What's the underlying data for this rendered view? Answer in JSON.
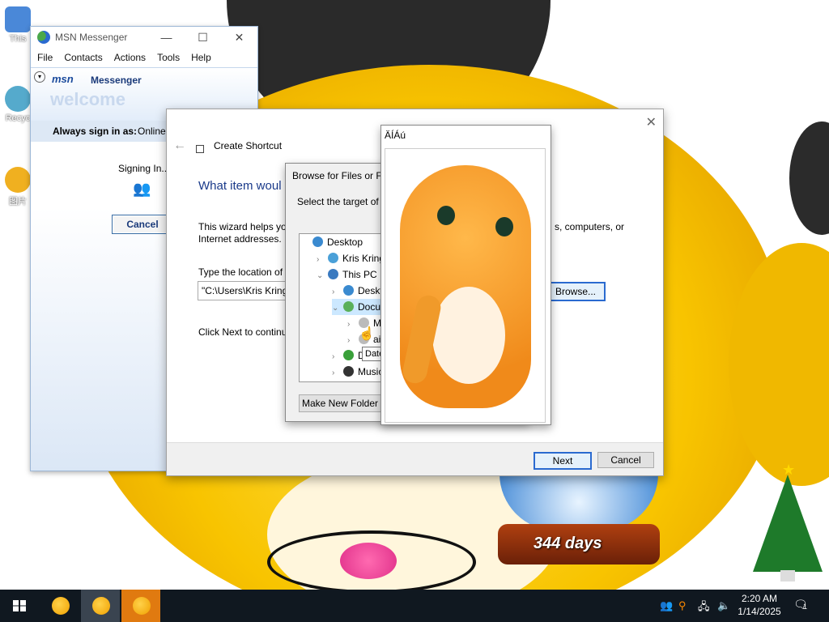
{
  "desktop": {
    "icons": [
      {
        "label": "This",
        "color": "#4a88d8"
      },
      {
        "label": "Recyc",
        "color": "#55aacc"
      },
      {
        "label": "图片",
        "color": "#f0b020"
      }
    ],
    "countdown": "344 days"
  },
  "msn": {
    "title": "MSN Messenger",
    "menu": [
      "File",
      "Contacts",
      "Actions",
      "Tools",
      "Help"
    ],
    "logo": "msn",
    "logo_suffix": "Messenger",
    "welcome": "welcome",
    "always_label": "Always sign in as:",
    "status": "Online",
    "signing_in": "Signing In...",
    "cancel": "Cancel"
  },
  "wizard": {
    "title": "Create Shortcut",
    "heading": "What item woul",
    "desc_line1": "This wizard helps you",
    "desc_line1_right": "s, computers, or",
    "desc_line2": "Internet addresses.",
    "type_location": "Type the location of",
    "location_value": "\"C:\\Users\\Kris Kring",
    "browse": "Browse...",
    "click_next": "Click Next to continu",
    "next": "Next",
    "cancel": "Cancel"
  },
  "browse_dialog": {
    "title": "Browse for Files or Fo",
    "prompt": "Select the target of th",
    "tree": [
      {
        "label": "Desktop",
        "level": 0,
        "chev": "",
        "color": "#3a8ad0"
      },
      {
        "label": "Kris Kringle",
        "level": 1,
        "chev": "›",
        "color": "#4aa0d8"
      },
      {
        "label": "This PC",
        "level": 1,
        "chev": "⌄",
        "color": "#3a7ac0"
      },
      {
        "label": "Desktop",
        "level": 2,
        "chev": "›",
        "color": "#3a8ad0"
      },
      {
        "label": "Docume",
        "level": 2,
        "chev": "⌄",
        "color": "#5ab05a",
        "selected": true
      },
      {
        "label": "My C",
        "level": 3,
        "chev": "›",
        "color": "#bbbbbb"
      },
      {
        "label": "ain",
        "level": 3,
        "chev": "›",
        "color": "#bbbbbb"
      },
      {
        "label": "Do",
        "level": 2,
        "chev": "›",
        "color": "#3aa03a"
      },
      {
        "label": "Music",
        "level": 2,
        "chev": "›",
        "color": "#333333"
      }
    ],
    "tooltip": "Date",
    "new_folder": "Make New Folder"
  },
  "preview": {
    "title": "ÄÍÁú"
  },
  "taskbar": {
    "time": "2:20 AM",
    "date": "1/14/2025",
    "notification_count": "1",
    "apps": [
      "duck-app",
      "duck-app",
      "duck-app"
    ]
  }
}
